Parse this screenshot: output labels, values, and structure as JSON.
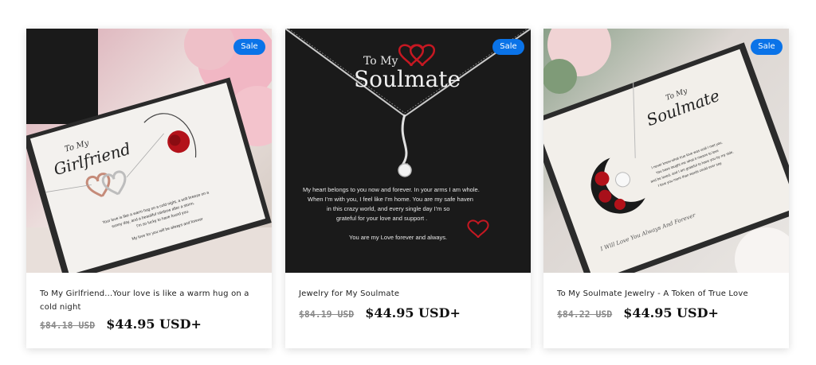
{
  "theme": {
    "badge_color": "#0a73e8",
    "text_color": "#1d1d1d",
    "old_price_color": "#8a8a8a"
  },
  "products": [
    {
      "badge": "Sale",
      "title": "To My Girlfriend...Your love is like a warm hug on a cold night",
      "old_price": "$84.18 USD",
      "price": "$44.95 USD+",
      "card_text": {
        "to": "To My",
        "name": "Girlfriend",
        "lines": [
          "Your love is like a warm hug on a cold night, a soft breeze on a",
          "sunny day, and a beautiful rainbow after a storm.",
          "I'm so lucky to have found you.",
          "My love for you will be always and forever"
        ]
      }
    },
    {
      "badge": "Sale",
      "title": "Jewelry for My Soulmate",
      "old_price": "$84.19 USD",
      "price": "$44.95 USD+",
      "card_text": {
        "to": "To My",
        "name": "Soulmate",
        "lines": [
          "My heart belongs to you now and forever. In your arms I am whole.",
          "When I'm with you, I feel like I'm home. You are my safe haven",
          "in this crazy world, and every single day I'm so",
          "grateful for your love and support .",
          "You are my Love forever and always."
        ]
      }
    },
    {
      "badge": "Sale",
      "title": "To My Soulmate Jewelry - A Token of True Love",
      "old_price": "$84.22 USD",
      "price": "$44.95 USD+",
      "card_text": {
        "to": "To My",
        "name": "Soulmate",
        "lines": [
          "I never knew what true love was until I met you.",
          "You have taught me what it means to love",
          "and be loved, and I am grateful to have you by my side.",
          "I love you more than words could ever say.",
          "I Will Love You Always And Forever"
        ]
      }
    }
  ]
}
